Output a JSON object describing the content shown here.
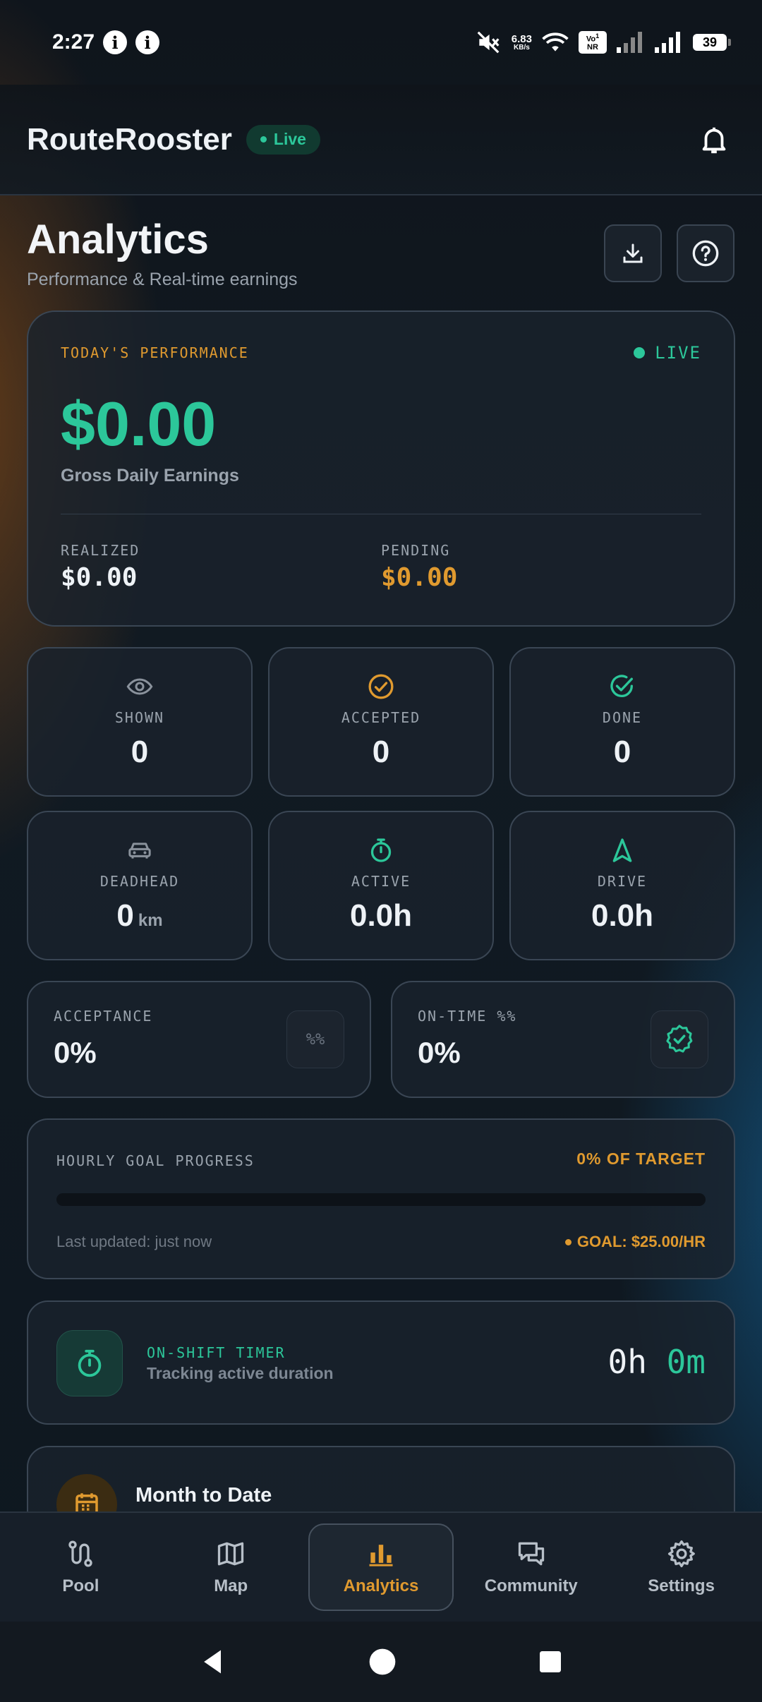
{
  "status_bar": {
    "time": "2:27",
    "info_glyph": "i",
    "net_speed": "6.83",
    "net_speed_unit": "KB/s",
    "volte_top": "Vo",
    "volte_bottom": "NR",
    "volte_sub": "1",
    "battery": "39",
    "icons": [
      "mute-icon",
      "wifi-icon",
      "signal-icon",
      "signal-icon",
      "battery-icon"
    ]
  },
  "header": {
    "app_name": "RouteRooster",
    "live_badge": "Live"
  },
  "page": {
    "title": "Analytics",
    "subtitle": "Performance & Real-time earnings"
  },
  "performance": {
    "label": "TODAY'S PERFORMANCE",
    "live": "LIVE",
    "gross": "$0.00",
    "gross_caption": "Gross Daily Earnings",
    "realized_label": "REALIZED",
    "realized_value": "$0.00",
    "pending_label": "PENDING",
    "pending_value": "$0.00"
  },
  "stats": [
    {
      "label": "SHOWN",
      "value": "0",
      "unit": "",
      "icon": "eye-icon"
    },
    {
      "label": "ACCEPTED",
      "value": "0",
      "unit": "",
      "icon": "check-circle-icon"
    },
    {
      "label": "DONE",
      "value": "0",
      "unit": "",
      "icon": "check-circle-icon"
    },
    {
      "label": "DEADHEAD",
      "value": "0",
      "unit": "km",
      "icon": "car-icon"
    },
    {
      "label": "ACTIVE",
      "value": "0.0h",
      "unit": "",
      "icon": "stopwatch-icon"
    },
    {
      "label": "DRIVE",
      "value": "0.0h",
      "unit": "",
      "icon": "navigation-arrow-icon"
    }
  ],
  "acceptance": {
    "label": "ACCEPTANCE",
    "value": "0%",
    "badge": "%%"
  },
  "on_time": {
    "label": "ON-TIME %%",
    "value": "0%",
    "icon": "verified-badge-icon"
  },
  "goal": {
    "label": "HOURLY GOAL PROGRESS",
    "target": "0% OF TARGET",
    "progress": 0,
    "updated": "Last updated: just now",
    "goal_text": "GOAL: $25.00/HR"
  },
  "timer": {
    "label": "ON-SHIFT TIMER",
    "subtitle": "Tracking active duration",
    "hours": "0h",
    "minutes": "0m"
  },
  "month": {
    "title": "Month to Date",
    "icon": "calendar-icon"
  },
  "nav": [
    {
      "label": "Pool",
      "icon": "route-icon",
      "active": false
    },
    {
      "label": "Map",
      "icon": "map-icon",
      "active": false
    },
    {
      "label": "Analytics",
      "icon": "bar-chart-icon",
      "active": true
    },
    {
      "label": "Community",
      "icon": "chat-icon",
      "active": false
    },
    {
      "label": "Settings",
      "icon": "gear-icon",
      "active": false
    }
  ],
  "colors": {
    "accent_green": "#2cc79a",
    "accent_orange": "#e09a2f",
    "background": "#111a22"
  }
}
